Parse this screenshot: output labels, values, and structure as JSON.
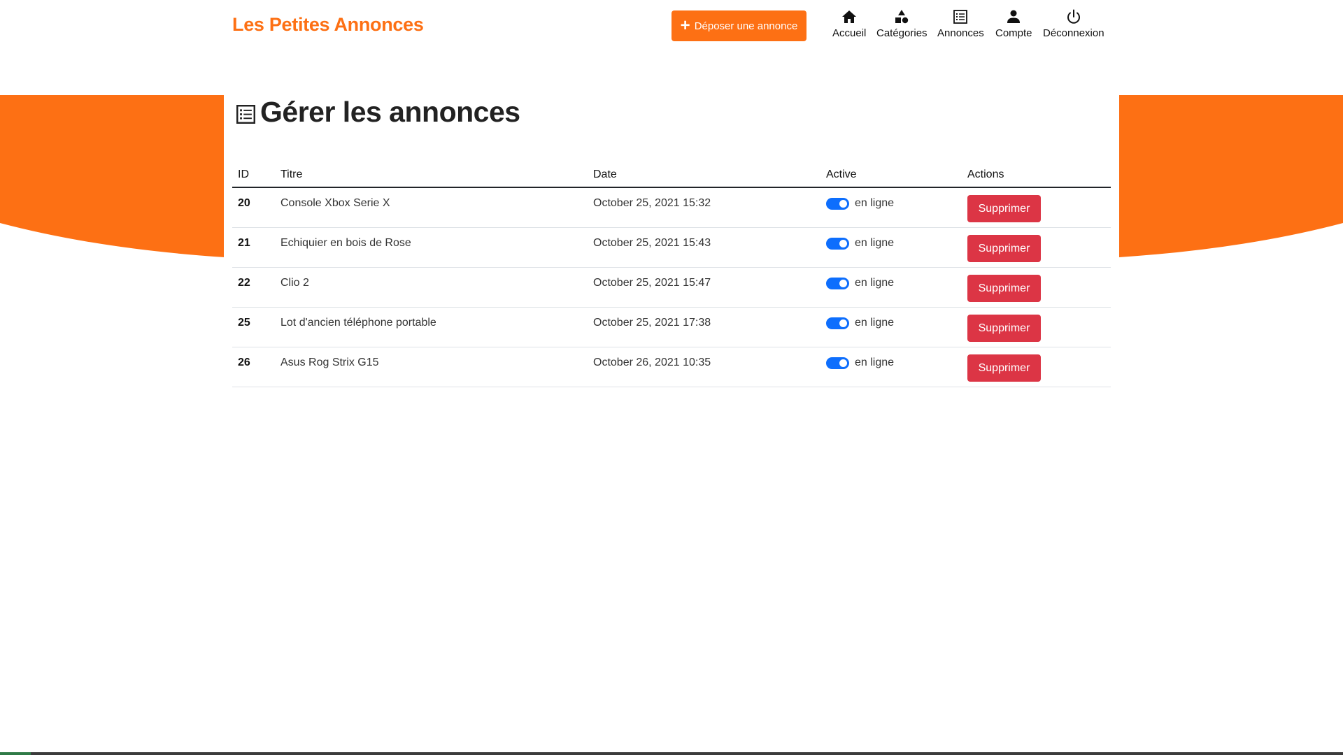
{
  "brand": {
    "name": "Les Petites Annonces",
    "color": "#fd7014"
  },
  "header": {
    "post_button": {
      "label": "Déposer une annonce",
      "icon": "plus-icon"
    },
    "nav": [
      {
        "label": "Accueil",
        "icon": "home-icon"
      },
      {
        "label": "Catégories",
        "icon": "shapes-icon"
      },
      {
        "label": "Annonces",
        "icon": "list-icon"
      },
      {
        "label": "Compte",
        "icon": "user-icon"
      },
      {
        "label": "Déconnexion",
        "icon": "power-icon"
      }
    ]
  },
  "main": {
    "title": "Gérer les annonces",
    "title_icon": "list-icon",
    "table": {
      "headers": {
        "id": "ID",
        "title": "Titre",
        "date": "Date",
        "active": "Active",
        "actions": "Actions"
      },
      "rows": [
        {
          "id": "20",
          "title": "Console Xbox Serie X",
          "date": "October 25, 2021 15:32",
          "status": "en ligne",
          "active": true,
          "action": "Supprimer"
        },
        {
          "id": "21",
          "title": "Echiquier en bois de Rose",
          "date": "October 25, 2021 15:43",
          "status": "en ligne",
          "active": true,
          "action": "Supprimer"
        },
        {
          "id": "22",
          "title": "Clio 2",
          "date": "October 25, 2021 15:47",
          "status": "en ligne",
          "active": true,
          "action": "Supprimer"
        },
        {
          "id": "25",
          "title": "Lot d'ancien téléphone portable",
          "date": "October 25, 2021 17:38",
          "status": "en ligne",
          "active": true,
          "action": "Supprimer"
        },
        {
          "id": "26",
          "title": "Asus Rog Strix G15",
          "date": "October 26, 2021 10:35",
          "status": "en ligne",
          "active": true,
          "action": "Supprimer"
        }
      ]
    }
  },
  "colors": {
    "accent": "#fd7014",
    "danger": "#dc3545",
    "toggle": "#0d6efd"
  }
}
